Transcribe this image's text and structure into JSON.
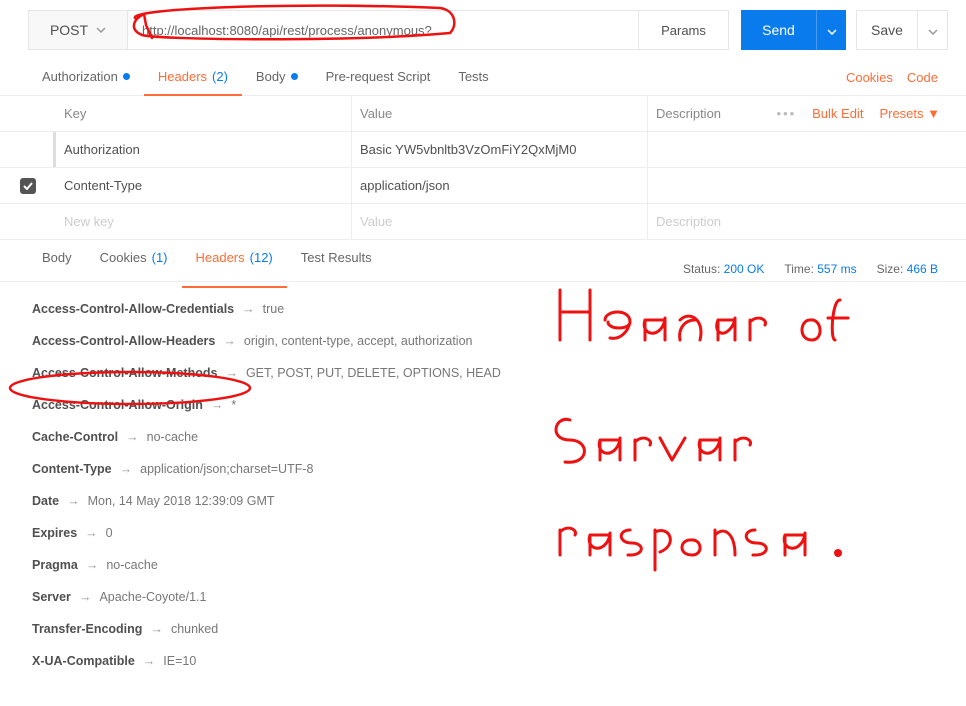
{
  "request": {
    "method": "POST",
    "url": "http://localhost:8080/api/rest/process/anonymous?",
    "params_label": "Params",
    "send_label": "Send",
    "save_label": "Save"
  },
  "req_tabs": {
    "authorization": "Authorization",
    "headers_label": "Headers",
    "headers_count": "(2)",
    "body": "Body",
    "prerequest": "Pre-request Script",
    "tests": "Tests",
    "cookies_link": "Cookies",
    "code_link": "Code"
  },
  "hdr_table": {
    "col_key": "Key",
    "col_value": "Value",
    "col_desc": "Description",
    "bulk_edit": "Bulk Edit",
    "presets": "Presets ▼",
    "rows": [
      {
        "key": "Authorization",
        "value": "Basic YW5vbnltb3VzOmFiY2QxMjM0",
        "checked": false
      },
      {
        "key": "Content-Type",
        "value": "application/json",
        "checked": true
      }
    ],
    "new_key": "New key",
    "new_value": "Value",
    "new_desc": "Description"
  },
  "resp_tabs": {
    "body": "Body",
    "cookies_label": "Cookies",
    "cookies_count": "(1)",
    "headers_label": "Headers",
    "headers_count": "(12)",
    "test_results": "Test Results"
  },
  "resp_meta": {
    "status_label": "Status:",
    "status_value": "200 OK",
    "time_label": "Time:",
    "time_value": "557 ms",
    "size_label": "Size:",
    "size_value": "466 B"
  },
  "response_headers": [
    {
      "k": "Access-Control-Allow-Credentials",
      "v": "true"
    },
    {
      "k": "Access-Control-Allow-Headers",
      "v": "origin, content-type, accept, authorization"
    },
    {
      "k": "Access-Control-Allow-Methods",
      "v": "GET, POST, PUT, DELETE, OPTIONS, HEAD"
    },
    {
      "k": "Access-Control-Allow-Origin",
      "v": "*"
    },
    {
      "k": "Cache-Control",
      "v": "no-cache"
    },
    {
      "k": "Content-Type",
      "v": "application/json;charset=UTF-8"
    },
    {
      "k": "Date",
      "v": "Mon, 14 May 2018 12:39:09 GMT"
    },
    {
      "k": "Expires",
      "v": "0"
    },
    {
      "k": "Pragma",
      "v": "no-cache"
    },
    {
      "k": "Server",
      "v": "Apache-Coyote/1.1"
    },
    {
      "k": "Transfer-Encoding",
      "v": "chunked"
    },
    {
      "k": "X-UA-Compatible",
      "v": "IE=10"
    }
  ],
  "annotations": {
    "handwriting": "Header of server response."
  }
}
